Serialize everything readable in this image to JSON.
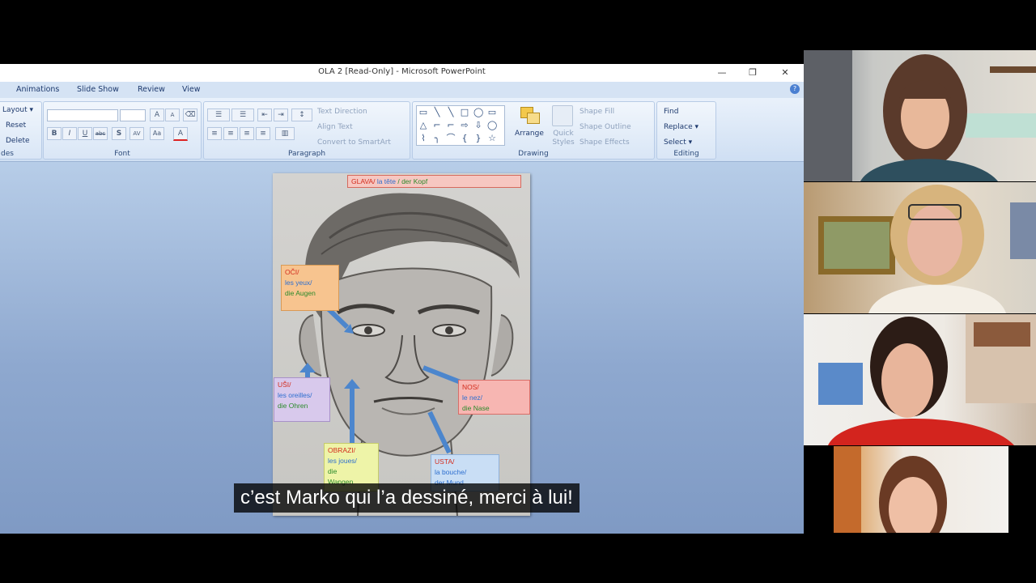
{
  "window": {
    "title": "OLA 2 [Read-Only] - Microsoft PowerPoint",
    "minimize": "—",
    "restore": "❐",
    "close": "✕"
  },
  "tabs": [
    "Animations",
    "Slide Show",
    "Review",
    "View"
  ],
  "ribbon": {
    "slides": {
      "label": "des",
      "layout": "Layout ▾",
      "reset": "Reset",
      "delete": "Delete"
    },
    "font": {
      "label": "Font",
      "grow": "A",
      "shrink": "A",
      "clear": "⌫",
      "bold": "B",
      "italic": "I",
      "underline": "U",
      "strike": "abc",
      "shadow": "S",
      "spacing": "AV",
      "case": "Aa",
      "color": "A"
    },
    "paragraph": {
      "label": "Paragraph",
      "text_direction": "Text Direction",
      "align_text": "Align Text",
      "convert_smartart": "Convert to SmartArt"
    },
    "drawing": {
      "label": "Drawing",
      "arrange": "Arrange",
      "quick_styles": "Quick Styles",
      "shape_fill": "Shape Fill",
      "shape_outline": "Shape Outline",
      "shape_effects": "Shape Effects",
      "shapes": [
        "▭",
        "╲",
        "╲",
        "□",
        "◯",
        "▭",
        "△",
        "⌐",
        "⌐",
        "⇨",
        "⇩",
        "◯",
        "⌇",
        "╮",
        "⌒",
        "{",
        "}",
        "☆"
      ]
    },
    "editing": {
      "label": "Editing",
      "find": "Find",
      "replace": "Replace ▾",
      "select": "Select ▾"
    }
  },
  "slide": {
    "header": {
      "red": "GLAVA/",
      "blue": "la tête",
      "green": "/ der Kopf"
    },
    "eyes": {
      "l1": "OČI/",
      "l2": "les yeux/",
      "l3": "die Augen"
    },
    "ears": {
      "l1": "UŠI/",
      "l2": "les oreilles/",
      "l3": "die Ohren"
    },
    "nose": {
      "l1": "NOS/",
      "l2": "le nez/",
      "l3": "die Nase"
    },
    "cheeks": {
      "l1": "OBRAZI/",
      "l2": "les joues/",
      "l3": "die",
      "l4": "Wangen"
    },
    "mouth": {
      "l1": "USTA/",
      "l2": "la bouche/",
      "l3": "der Mund"
    }
  },
  "subtitle": "c’est Marko qui l’a dessiné, merci à lui!"
}
